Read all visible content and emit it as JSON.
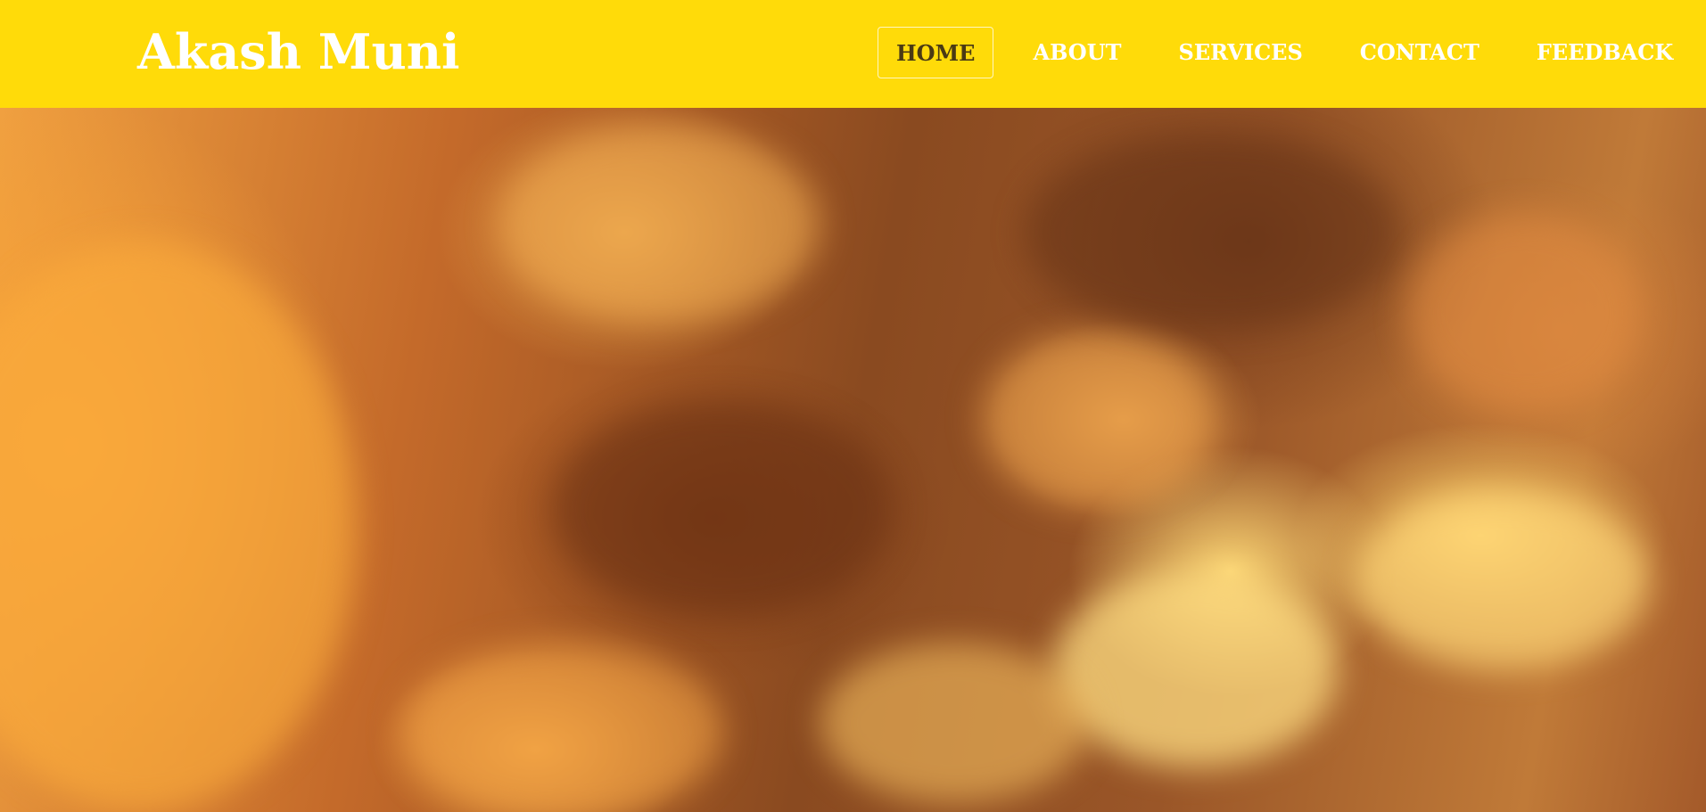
{
  "brand": {
    "name": "Akash Muni"
  },
  "nav": {
    "items": [
      {
        "label": "HOME",
        "active": true
      },
      {
        "label": "ABOUT",
        "active": false
      },
      {
        "label": "SERVICES",
        "active": false
      },
      {
        "label": "CONTACT",
        "active": false
      },
      {
        "label": "FEEDBACK",
        "active": false
      }
    ]
  },
  "colors": {
    "navbar_bg": "#ffdb09",
    "brand_text": "#ffffff",
    "nav_text": "#ffffff",
    "nav_active_text": "#4a3a14"
  },
  "hero": {
    "image": "orange-clouds-sky-background"
  }
}
